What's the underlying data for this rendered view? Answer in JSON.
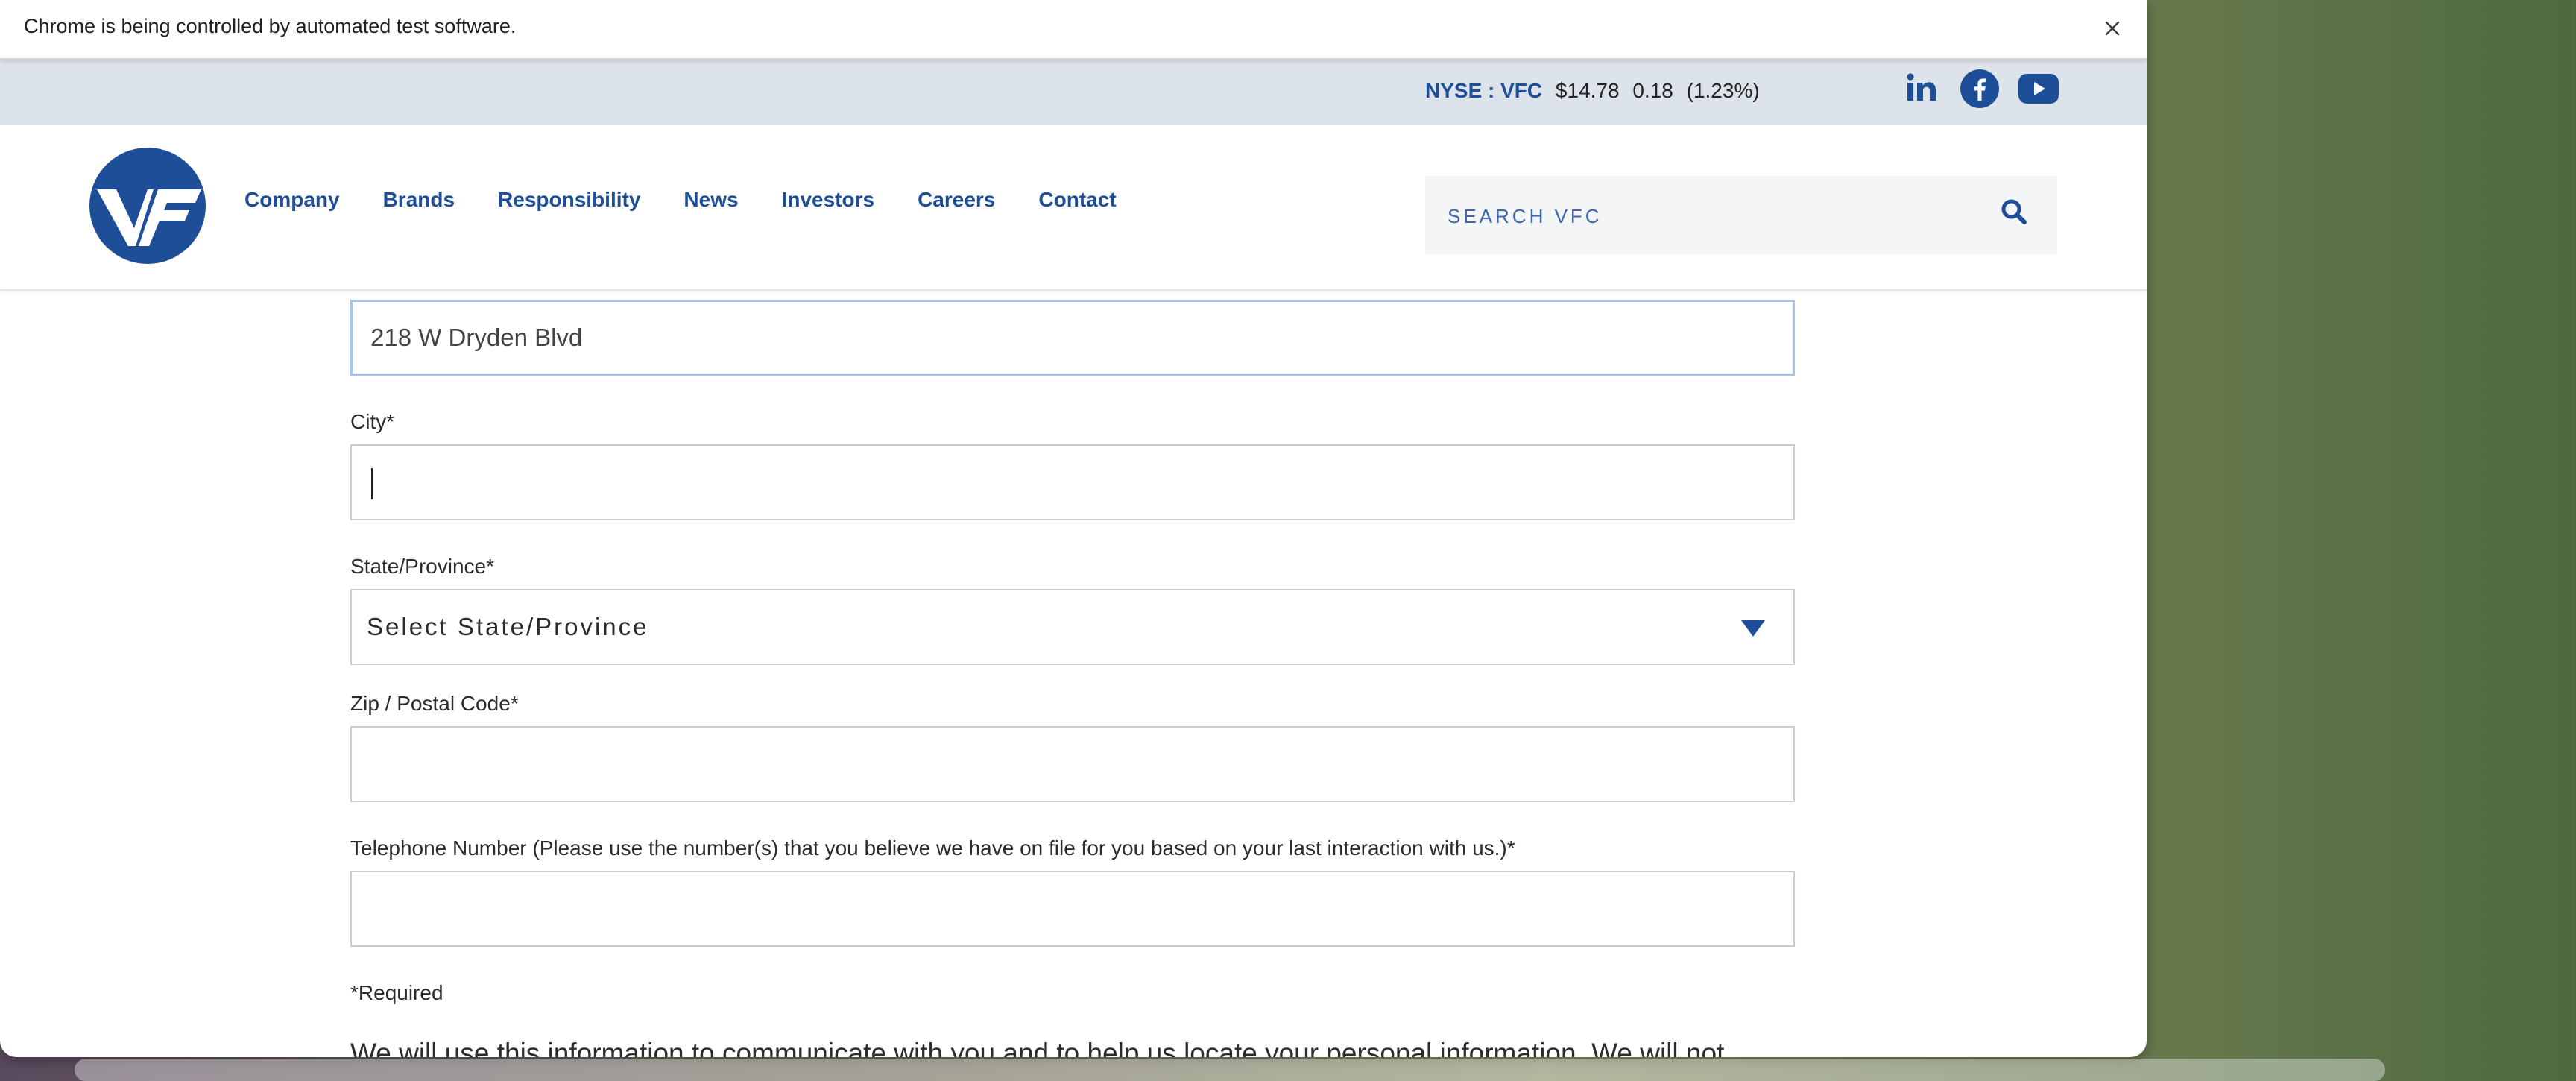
{
  "infobar": {
    "message": "Chrome is being controlled by automated test software.",
    "close_icon": "close-icon"
  },
  "stock": {
    "symbol": "NYSE : VFC",
    "price": "$14.78",
    "change": "0.18",
    "percent": "(1.23%)"
  },
  "social": {
    "icons": [
      "linkedin-icon",
      "facebook-icon",
      "youtube-icon"
    ],
    "brand_color": "#1f4e99"
  },
  "header": {
    "logo_icon": "vf-logo",
    "nav": [
      {
        "label": "Company"
      },
      {
        "label": "Brands"
      },
      {
        "label": "Responsibility"
      },
      {
        "label": "News"
      },
      {
        "label": "Investors"
      },
      {
        "label": "Careers"
      },
      {
        "label": "Contact"
      }
    ],
    "search": {
      "placeholder": "SEARCH VFC",
      "icon": "search-icon"
    }
  },
  "form": {
    "address_value": "218 W Dryden Blvd",
    "city_label": "City*",
    "city_value": "",
    "state_label": "State/Province*",
    "state_selected": "Select State/Province",
    "zip_label": "Zip / Postal Code*",
    "zip_value": "",
    "phone_label": "Telephone Number (Please use the number(s) that you believe we have on file for you based on your last interaction with us.)*",
    "phone_value": "",
    "required_note": "*Required",
    "privacy_text": "We will use this information to communicate with you and to help us locate your personal information. We will not"
  },
  "colors": {
    "accent": "#1f4e99",
    "stock_bar_bg": "#dde3ea",
    "active_field_border": "#a7c4ea"
  }
}
